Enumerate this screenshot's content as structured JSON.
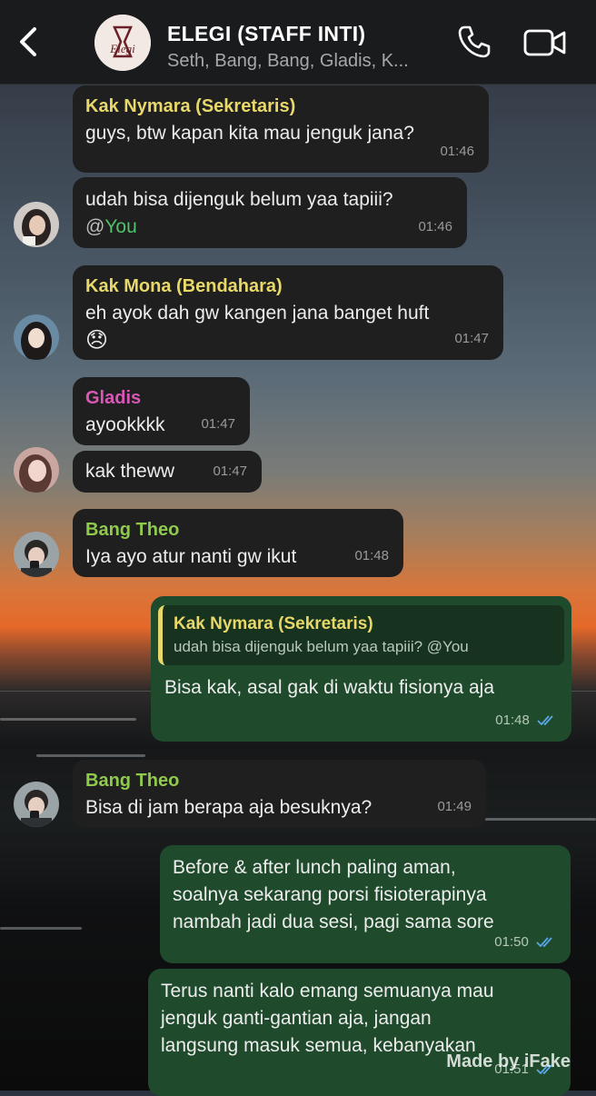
{
  "header": {
    "title": "ELEGI (STAFF INTI)",
    "subtitle": "Seth, Bang, Bang, Gladis, K...",
    "avatar_text": "Elegi"
  },
  "messages": [
    {
      "sender": "Kak Nymara (Sekretaris)",
      "sender_color": "#e8d86a",
      "text": "guys, btw kapan kita mau jenguk jana?",
      "time": "01:46"
    },
    {
      "text": "udah bisa dijenguk belum yaa tapiii?",
      "mention": "@You",
      "time": "01:46"
    },
    {
      "sender": "Kak Mona (Bendahara)",
      "sender_color": "#e8d86a",
      "text": "eh ayok dah gw kangen jana banget huft",
      "emoji": "😞",
      "time": "01:47"
    },
    {
      "sender": "Gladis",
      "sender_color": "#d957b6",
      "text": "ayookkkk",
      "time": "01:47"
    },
    {
      "text": "kak theww",
      "time": "01:47"
    },
    {
      "sender": "Bang Theo",
      "sender_color": "#8fca4c",
      "text": "Iya ayo atur nanti gw ikut",
      "time": "01:48"
    },
    {
      "reply": {
        "name": "Kak Nymara (Sekretaris)",
        "text": "udah bisa dijenguk belum yaa tapiii? @You"
      },
      "text": "Bisa kak, asal gak di waktu fisionya aja",
      "time": "01:48"
    },
    {
      "sender": "Bang Theo",
      "sender_color": "#8fca4c",
      "text": "Bisa di jam berapa aja besuknya?",
      "time": "01:49"
    },
    {
      "text_lines": [
        "Before & after lunch paling aman,",
        "soalnya sekarang porsi fisioterapinya",
        "nambah jadi dua sesi, pagi sama sore"
      ],
      "time": "01:50"
    },
    {
      "text_lines": [
        "Terus nanti kalo emang semuanya mau",
        "jenguk ganti-gantian aja, jangan",
        "langsung masuk semua, kebanyakan"
      ],
      "time": "01:51"
    }
  ],
  "watermark": "Made by iFake",
  "colors": {
    "header_bg": "#1a1b1d",
    "incoming_bubble": "#1f1f1f",
    "outgoing_bubble": "#1f4a2c",
    "read_ticks": "#5aa7e8"
  }
}
